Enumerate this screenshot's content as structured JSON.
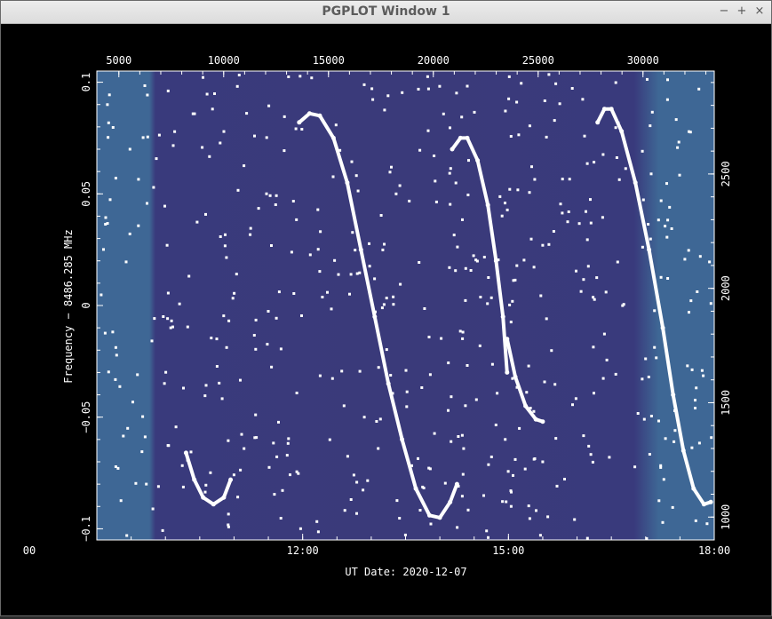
{
  "window": {
    "title": "PGPLOT Window 1",
    "controls": {
      "minimize": "−",
      "maximize": "+",
      "close": "×"
    }
  },
  "colors": {
    "background": "#000000",
    "plot_center": "#3a3a7a",
    "plot_edge": "#3e6795",
    "track": "#ffffff"
  },
  "chart_data": {
    "type": "scatter",
    "ylabel": "Frequency − 8486.285 MHz",
    "xlabel": "UT Date: 2020-12-07",
    "ylim": [
      -0.105,
      0.105
    ],
    "y_ticks": [
      "0.1",
      "0.05",
      "0",
      "−0.05",
      "−0.1"
    ],
    "y_tick_values": [
      0.1,
      0.05,
      0,
      -0.05,
      -0.1
    ],
    "x_time_ticks": [
      "00",
      "12:00",
      "15:00",
      "18:00"
    ],
    "x_time_hours": [
      8.0,
      12.0,
      15.0,
      18.0
    ],
    "xlim_hours": [
      9.0,
      18.0
    ],
    "top_ticks": [
      "5000",
      "10000",
      "15000",
      "20000",
      "25000",
      "30000"
    ],
    "top_tick_values": [
      5000,
      10000,
      15000,
      20000,
      25000,
      30000
    ],
    "top_range": [
      3950,
      33400
    ],
    "right_ticks": [
      "1000",
      "1500",
      "2000",
      "2500"
    ],
    "right_tick_values": [
      1000,
      1500,
      2000,
      2500
    ],
    "right_range": [
      900,
      2950
    ],
    "grid": false,
    "legend": "none",
    "series": [
      {
        "points": [
          [
            10.3,
            -0.066
          ],
          [
            10.42,
            -0.078
          ],
          [
            10.55,
            -0.086
          ],
          [
            10.7,
            -0.089
          ],
          [
            10.85,
            -0.086
          ],
          [
            10.95,
            -0.078
          ]
        ]
      },
      {
        "points": [
          [
            11.95,
            0.082
          ],
          [
            12.1,
            0.086
          ],
          [
            12.25,
            0.085
          ],
          [
            12.45,
            0.075
          ],
          [
            12.65,
            0.055
          ],
          [
            12.85,
            0.025
          ],
          [
            13.05,
            -0.005
          ],
          [
            13.25,
            -0.035
          ],
          [
            13.45,
            -0.06
          ],
          [
            13.65,
            -0.082
          ],
          [
            13.85,
            -0.094
          ],
          [
            14.0,
            -0.095
          ],
          [
            14.15,
            -0.088
          ],
          [
            14.25,
            -0.08
          ]
        ]
      },
      {
        "points": [
          [
            14.18,
            0.07
          ],
          [
            14.3,
            0.075
          ],
          [
            14.4,
            0.075
          ],
          [
            14.55,
            0.065
          ],
          [
            14.7,
            0.045
          ],
          [
            14.82,
            0.02
          ],
          [
            14.92,
            -0.005
          ],
          [
            14.98,
            -0.03
          ]
        ]
      },
      {
        "points": [
          [
            14.98,
            -0.015
          ],
          [
            15.1,
            -0.032
          ],
          [
            15.25,
            -0.045
          ],
          [
            15.4,
            -0.051
          ],
          [
            15.5,
            -0.052
          ]
        ]
      },
      {
        "points": [
          [
            16.3,
            0.082
          ],
          [
            16.4,
            0.088
          ],
          [
            16.5,
            0.088
          ],
          [
            16.65,
            0.078
          ],
          [
            16.85,
            0.055
          ],
          [
            17.05,
            0.025
          ],
          [
            17.25,
            -0.01
          ],
          [
            17.4,
            -0.04
          ],
          [
            17.55,
            -0.065
          ],
          [
            17.7,
            -0.082
          ],
          [
            17.85,
            -0.089
          ],
          [
            17.95,
            -0.088
          ]
        ]
      }
    ]
  }
}
